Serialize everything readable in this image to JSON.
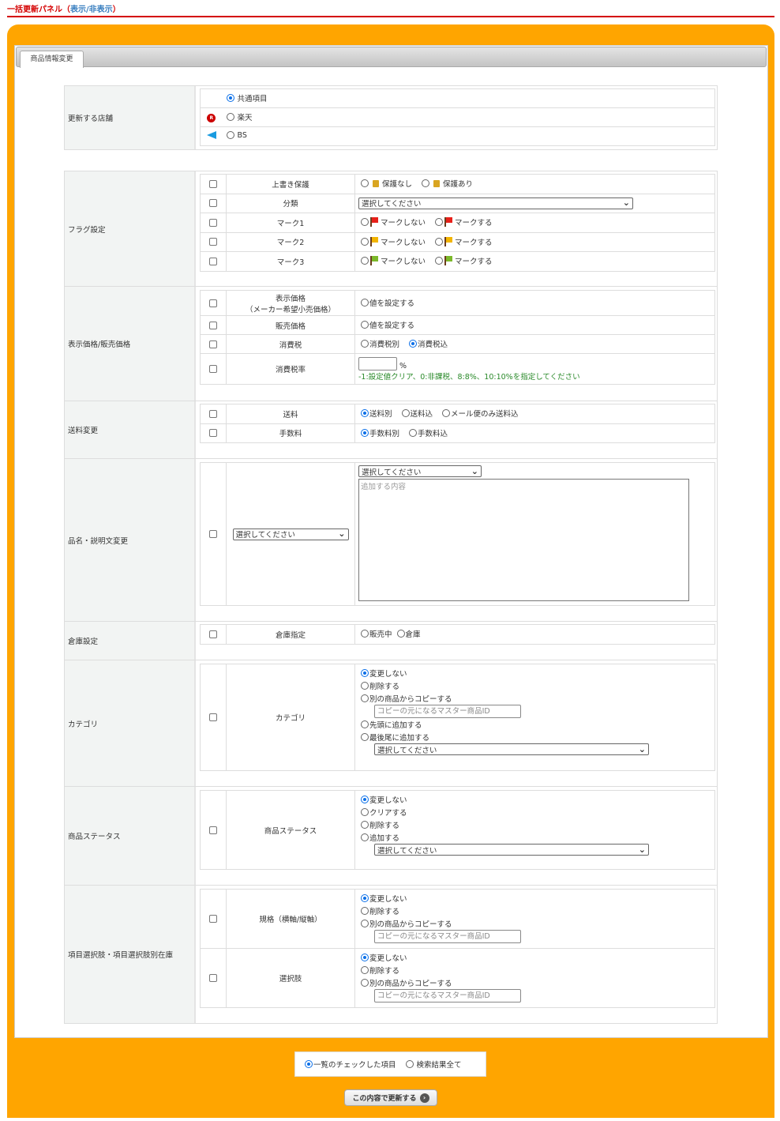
{
  "header": {
    "title": "一括更新パネル",
    "toggle_open": "（",
    "toggle_link": "表示/非表示",
    "toggle_close": "）"
  },
  "tab": "商品情報変更",
  "store": {
    "label": "更新する店舗",
    "options": [
      "共通項目",
      "楽天",
      "BS"
    ]
  },
  "flags": {
    "label": "フラグ設定",
    "rows": [
      {
        "label": "上書き保護",
        "opts": [
          "保護なし",
          "保護あり"
        ]
      },
      {
        "label": "分類",
        "select": "選択してください"
      },
      {
        "label": "マーク1",
        "opts": [
          "マークしない",
          "マークする"
        ]
      },
      {
        "label": "マーク2",
        "opts": [
          "マークしない",
          "マークする"
        ]
      },
      {
        "label": "マーク3",
        "opts": [
          "マークしない",
          "マークする"
        ]
      }
    ]
  },
  "price": {
    "label": "表示価格/販売価格",
    "rows": [
      {
        "label1": "表示価格",
        "label2": "（メーカー希望小売価格）",
        "opt": "値を設定する"
      },
      {
        "label": "販売価格",
        "opt": "値を設定する"
      },
      {
        "label": "消費税",
        "opts": [
          "消費税別",
          "消費税込"
        ]
      },
      {
        "label": "消費税率",
        "unit": "%",
        "hint": "-1:設定値クリア、0:非課税、8:8%、10:10%を指定してください"
      }
    ]
  },
  "shipping": {
    "label": "送料変更",
    "rows": [
      {
        "label": "送料",
        "opts": [
          "送料別",
          "送料込",
          "メール便のみ送料込"
        ]
      },
      {
        "label": "手数料",
        "opts": [
          "手数料別",
          "手数料込"
        ]
      }
    ]
  },
  "name": {
    "label": "品名・説明文変更",
    "field_select": "選択してください",
    "mode_select": "選択してください",
    "placeholder": "追加する内容"
  },
  "warehouse": {
    "label": "倉庫設定",
    "row_label": "倉庫指定",
    "opts": [
      "販売中",
      "倉庫"
    ]
  },
  "category": {
    "label": "カテゴリ",
    "row_label": "カテゴリ",
    "opts": [
      "変更しない",
      "削除する",
      "別の商品からコピーする",
      "先頭に追加する",
      "最後尾に追加する"
    ],
    "placeholder": "コピーの元になるマスター商品ID",
    "select": "選択してください"
  },
  "status": {
    "label": "商品ステータス",
    "row_label": "商品ステータス",
    "opts": [
      "変更しない",
      "クリアする",
      "削除する",
      "追加する"
    ],
    "select": "選択してください"
  },
  "options": {
    "label": "項目選択肢・項目選択肢別在庫",
    "rows": [
      {
        "label": "規格（横軸/縦軸）",
        "opts": [
          "変更しない",
          "削除する",
          "別の商品からコピーする"
        ],
        "placeholder": "コピーの元になるマスター商品ID"
      },
      {
        "label": "選択肢",
        "opts": [
          "変更しない",
          "削除する",
          "別の商品からコピーする"
        ],
        "placeholder": "コピーの元になるマスター商品ID"
      }
    ]
  },
  "target": {
    "opts": [
      "一覧のチェックした項目",
      "検索結果全て"
    ]
  },
  "submit": "この内容で更新する",
  "colors": {
    "accent": "#ffa500",
    "header": "#d40000",
    "radio": "#0a6fe8"
  }
}
